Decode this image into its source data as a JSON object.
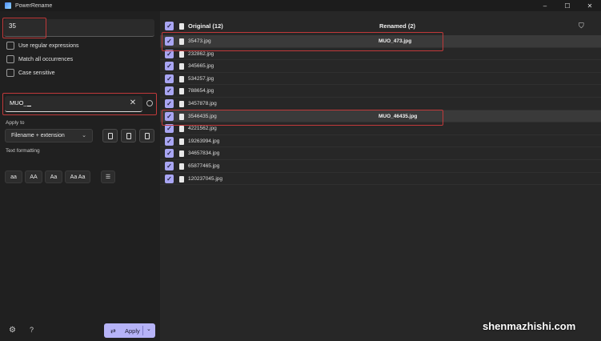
{
  "window": {
    "title": "PowerRename",
    "controls": [
      "–",
      "☐",
      "✕"
    ]
  },
  "search": {
    "value": "35"
  },
  "options": [
    {
      "label": "Use regular expressions",
      "checked": false
    },
    {
      "label": "Match all occurrences",
      "checked": false
    },
    {
      "label": "Case sensitive",
      "checked": false
    }
  ],
  "replace": {
    "value": "MUO_"
  },
  "apply_to": {
    "label": "Apply to",
    "selected": "Filename + extension"
  },
  "text_formatting": {
    "label": "Text formatting",
    "buttons": [
      "aa",
      "AA",
      "Aa",
      "Aa Aa"
    ]
  },
  "apply_button": {
    "label": "Apply"
  },
  "file_list": {
    "original_header": "Original (12)",
    "renamed_header": "Renamed (2)",
    "rows": [
      {
        "original": "35473.jpg",
        "renamed": "MUO_473.jpg",
        "selected": true
      },
      {
        "original": "232862.jpg",
        "renamed": ""
      },
      {
        "original": "345665.jpg",
        "renamed": ""
      },
      {
        "original": "534257.jpg",
        "renamed": ""
      },
      {
        "original": "788654.jpg",
        "renamed": ""
      },
      {
        "original": "3457878.jpg",
        "renamed": ""
      },
      {
        "original": "3546435.jpg",
        "renamed": "MUO_46435.jpg",
        "selected": true
      },
      {
        "original": "4221562.jpg",
        "renamed": ""
      },
      {
        "original": "19263994.jpg",
        "renamed": ""
      },
      {
        "original": "34657834.jpg",
        "renamed": ""
      },
      {
        "original": "65877465.jpg",
        "renamed": ""
      },
      {
        "original": "120237045.jpg",
        "renamed": ""
      }
    ]
  },
  "watermark": "shenmazhishi.com",
  "colors": {
    "accent": "#a9a6f3",
    "highlight": "#c0393a"
  }
}
